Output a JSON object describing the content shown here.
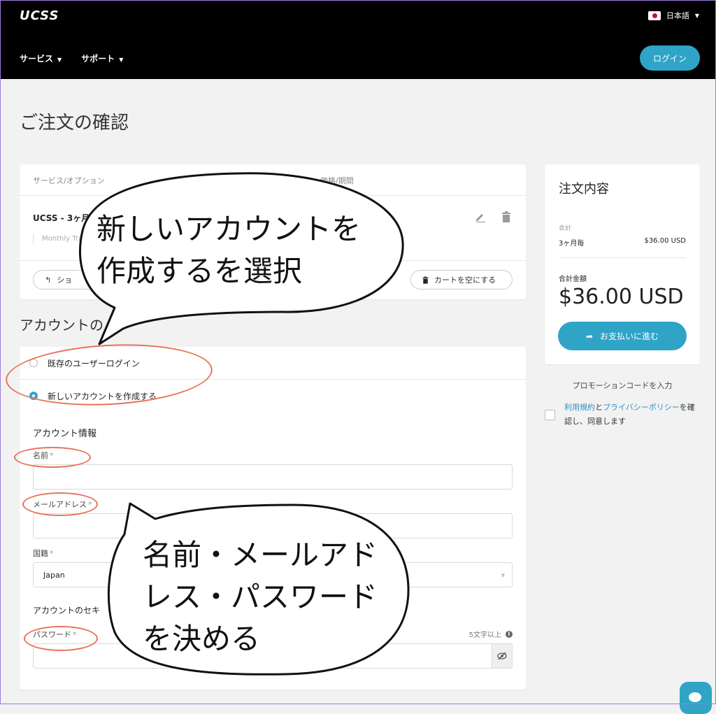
{
  "header": {
    "logo": "UCSS",
    "language": "日本語",
    "nav": [
      "サービス",
      "サポート"
    ],
    "login_label": "ログイン"
  },
  "page_title": "ご注文の確認",
  "cart": {
    "col_service": "サービス/オプション",
    "col_price": "価格/期間",
    "item_name": "UCSS - 3ヶ月",
    "item_sub": "Monthly Tra",
    "continue_label": "ショ",
    "empty_cart_label": "カートを空にする"
  },
  "account_section_title": "アカウントの",
  "account": {
    "existing_login": "既存のユーザーログイン",
    "create_new": "新しいアカウントを作成する",
    "info_title": "アカウント情報",
    "name_label": "名前",
    "email_label": "メールアドレス",
    "country_label": "国籍",
    "country_value": "Japan",
    "security_title": "アカウントのセキ",
    "password_label": "パスワード",
    "password_hint": "5文字以上",
    "required_mark": "*"
  },
  "summary": {
    "title": "注文内容",
    "subtotal_label": "合計",
    "cycle": "3ヶ月毎",
    "cycle_amount": "$36.00 USD",
    "total_label": "合計金額",
    "total": "$36.00 USD",
    "checkout_label": "お支払いに進む"
  },
  "promo_label": "プロモーションコードを入力",
  "terms": {
    "link1": "利用規約",
    "and": "と",
    "link2": "プライバシーポリシー",
    "rest": "を確認し、同意します"
  },
  "annotations": {
    "callout_top_line1": "新しいアカウントを",
    "callout_top_line2": "作成するを選択",
    "callout_bottom_line1": "名前・メールアド",
    "callout_bottom_line2": "レス・パスワード",
    "callout_bottom_line3": "を決める"
  },
  "colors": {
    "accent": "#2fa4c7",
    "annotation": "#e8735a",
    "header_bg": "#000000"
  }
}
